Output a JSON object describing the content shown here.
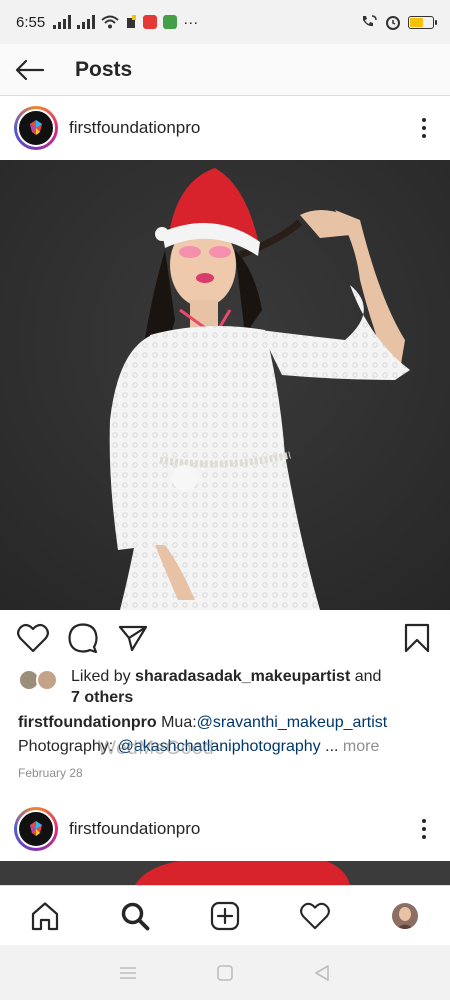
{
  "status_bar": {
    "time": "6:55",
    "more": "···",
    "battery_level": 0.6,
    "colors": {
      "battery": "#f4c20d"
    }
  },
  "header": {
    "title": "Posts"
  },
  "post1": {
    "username": "firstfoundationpro",
    "likes": {
      "prefix": "Liked by ",
      "user": "sharadasadak_makeupartist",
      "and": " and",
      "others": "7 others"
    },
    "caption": {
      "username": "firstfoundationpro",
      "mua_label": " Mua:",
      "mua_mention": "@sravanthi_makeup_artist",
      "photo_label": "Photography: ",
      "photo_mention": "@akashchatlaniphotography",
      "ellipsis": " ...",
      "more": " more"
    },
    "watermark": "WedMeGood",
    "date": "February 28"
  },
  "post2": {
    "username": "firstfoundationpro"
  },
  "icons": {
    "back": "back-arrow-icon",
    "like": "heart-icon",
    "comment": "comment-icon",
    "share": "send-icon",
    "save": "bookmark-icon",
    "home": "home-icon",
    "search": "search-icon",
    "add": "add-post-icon",
    "activity": "heart-icon",
    "profile": "profile-avatar"
  },
  "colors": {
    "mention": "#00376b",
    "muted": "#8e8e8e",
    "text": "#262626"
  }
}
